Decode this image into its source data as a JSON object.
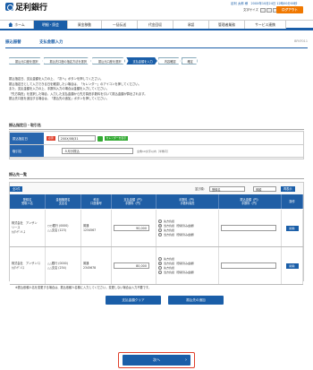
{
  "header": {
    "bank_name": "足利銀行",
    "user_line": "足利 太郎 様　20XX年10月24日 12時00分00秒",
    "font_size_label": "文字サイズ",
    "font_sizes": [
      "小",
      "中",
      "大"
    ],
    "logout_label": "ログアウト"
  },
  "nav": {
    "items": [
      {
        "label": "ホーム",
        "active": false
      },
      {
        "label": "明細・照会",
        "active": true
      },
      {
        "label": "資金移動",
        "active": false
      },
      {
        "label": "一括伝送",
        "active": false
      },
      {
        "label": "代金回収",
        "active": false
      },
      {
        "label": "承認",
        "active": false
      },
      {
        "label": "管理者業務",
        "active": false
      },
      {
        "label": "サービス連携",
        "active": false
      }
    ]
  },
  "page": {
    "category": "振込振替",
    "title": "支払金額入力",
    "code": "BFKF011"
  },
  "steps": [
    {
      "label": "振込元口座を選択",
      "active": false
    },
    {
      "label": "振込先口座の指定方法を選択",
      "active": false
    },
    {
      "label": "振込元口座を選択",
      "active": false
    },
    {
      "label": "支払金額を入力",
      "active": true
    },
    {
      "label": "内容確認",
      "active": false
    },
    {
      "label": "確定",
      "active": false
    }
  ],
  "notes": [
    "振込指定日、支払金額を入力の上、「次へ」ボタンを押してください。",
    "振込指定日として入力できる日を確認したい場合は、「カレンダー」のアイコンを押してください。",
    "また、支払金額を入力の上、手数料入力の場合は金額を入力してください。",
    "「先方負担」を選択した場合、入力した支払金額から先方負担手数料を引いて振込金額が算出されます。",
    "振込先口座を追加する場合は、「振込先の追加」ボタンを押してください。"
  ],
  "form_section": {
    "title": "振込指定日・取引名",
    "date_label": "振込指定日",
    "required": "必須",
    "date_value": "20XX/08/31",
    "calendar_label": "カレンダーを表示",
    "name_label": "取引名",
    "name_value": "８月分振込",
    "name_hint": "全角10文字以内［半角可］"
  },
  "list_section": {
    "title": "振込先一覧",
    "count": "全2件",
    "sort_label": "並び順：",
    "sort_value": "登録名",
    "order_value": "昇順",
    "sort_button": "再表示",
    "columns": [
      "登録名\n受取人名",
      "金融機関名\n支店名",
      "科目\n口座番号",
      "支払金額（円）\n手数料（円）",
      "手数料（円）\n手数料負担",
      "振込金額（円）\n手数料（円）",
      "操作"
    ],
    "rows": [
      {
        "reg_name": "株式会社　アンザン\nリース\nｶ)ｱﾝｻﾞﾝﾘ-ｽ",
        "bank": "○○銀行 (0000)\n△△支店 (123)",
        "account": "普通\n1234567",
        "amount": "90,000",
        "options": [
          "先方負担",
          "当方負担（登録済み金額）",
          "先方負担",
          "当方負担（登録済み金額）"
        ],
        "delete": "削除"
      },
      {
        "reg_name": "株式会社　アンザンﾐｽ\nｶ)ｱﾝｻﾞﾝﾐｽ",
        "bank": "△△銀行 (0000)\n△△支店 (234)",
        "account": "普通\n2345678",
        "amount": "80,000",
        "options": [
          "先方負担",
          "当方負担（登録済み金額）",
          "先方負担",
          "当方負担（登録済み金額）"
        ],
        "delete": "削除"
      }
    ],
    "footnote": "※振込依頼人名を変更する場合は、振込依頼人名欄に入力してください。変更しない場合は入力不要です。",
    "clear_button": "支払金額クリア",
    "add_button": "振込先の追加"
  },
  "next_button": "次へ"
}
